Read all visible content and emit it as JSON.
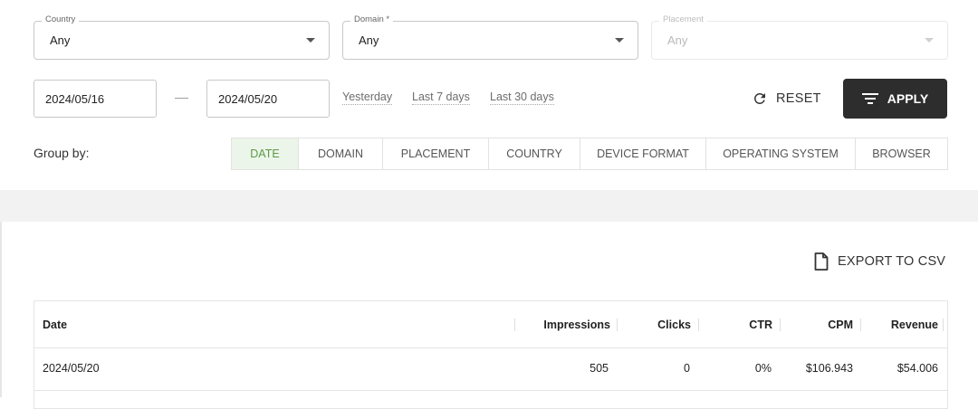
{
  "filters": {
    "country": {
      "label": "Country",
      "value": "Any"
    },
    "domain": {
      "label": "Domain *",
      "value": "Any"
    },
    "placement": {
      "label": "Placement",
      "value": "Any"
    }
  },
  "date_range": {
    "start": "2024/05/16",
    "end": "2024/05/20",
    "quick_ranges": [
      "Yesterday",
      "Last 7 days",
      "Last 30 days"
    ]
  },
  "actions": {
    "reset": "RESET",
    "apply": "APPLY",
    "export": "EXPORT TO CSV"
  },
  "group_by": {
    "label": "Group by:",
    "options": [
      "DATE",
      "DOMAIN",
      "PLACEMENT",
      "COUNTRY",
      "DEVICE FORMAT",
      "OPERATING SYSTEM",
      "BROWSER"
    ],
    "active": "DATE"
  },
  "table": {
    "columns": [
      "Date",
      "Impressions",
      "Clicks",
      "CTR",
      "CPM",
      "Revenue"
    ],
    "rows": [
      [
        "2024/05/20",
        "505",
        "0",
        "0%",
        "$106.943",
        "$54.006"
      ]
    ]
  },
  "colors": {
    "accent": "#5b9a48",
    "accent_bg": "#ecf5e9",
    "primary_button": "#2d2d2d"
  }
}
